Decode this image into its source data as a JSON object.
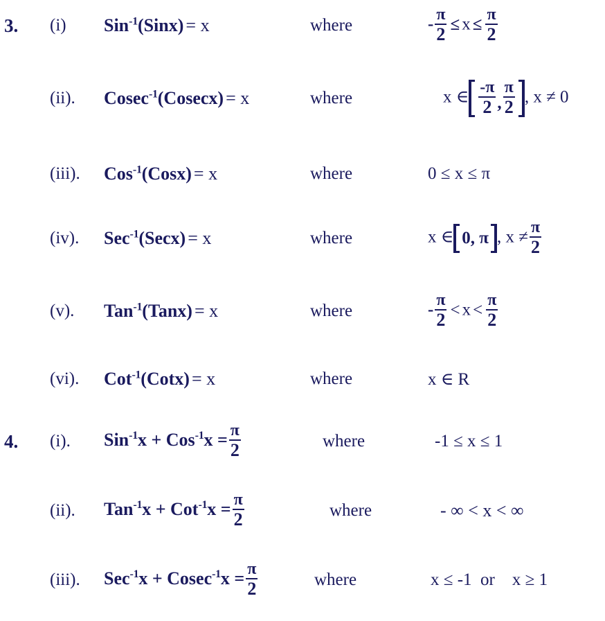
{
  "document": {
    "text_color": "#1a1a5e",
    "background_color": "#ffffff",
    "where_label": "where"
  },
  "groups": [
    {
      "number": "3.",
      "items": [
        {
          "label": "(i)",
          "formula": {
            "func": "Sin",
            "inverse": "-1",
            "arg": "(Sinx)",
            "equals": "= x"
          },
          "where": "where",
          "condition": {
            "type": "fraction_inequality",
            "lead": "-",
            "left_num": "π",
            "left_den": "2",
            "rel1": "≤",
            "var": "x",
            "rel2": "≤",
            "right_num": "π",
            "right_den": "2",
            "text": "-π/2 ≤ x ≤ π/2"
          }
        },
        {
          "label": "(ii).",
          "formula": {
            "func": "Cosec",
            "inverse": "-1",
            "arg": "(Cosecx)",
            "equals": "= x"
          },
          "where": "where",
          "condition": {
            "type": "interval_bracket_two_fractions",
            "member": "x ∈",
            "left_num": "-π",
            "left_den": "2",
            "sep": ",",
            "right_num": "π",
            "right_den": "2",
            "suffix": ", x ≠ 0",
            "text": "x ∈ [-π/2, π/2], x ≠ 0"
          }
        },
        {
          "label": "(iii).",
          "formula": {
            "func": "Cos",
            "inverse": "-1",
            "arg": "(Cosx)",
            "equals": "= x"
          },
          "where": "where",
          "condition": {
            "type": "simple",
            "text": "0 ≤ x ≤ π"
          }
        },
        {
          "label": "(iv).",
          "formula": {
            "func": "Sec",
            "inverse": "-1",
            "arg": "(Secx)",
            "equals": "= x"
          },
          "where": "where",
          "condition": {
            "type": "interval_bracket_plain",
            "member": "x ∈",
            "inner": "0, π",
            "mid": ", x ≠",
            "frac_num": "π",
            "frac_den": "2",
            "text": "x ∈ [0, π], x ≠ π/2"
          }
        },
        {
          "label": "(v).",
          "formula": {
            "func": "Tan",
            "inverse": "-1",
            "arg": "(Tanx)",
            "equals": "= x"
          },
          "where": "where",
          "condition": {
            "type": "fraction_inequality",
            "lead": "-",
            "left_num": "π",
            "left_den": "2",
            "rel1": "<",
            "var": "x",
            "rel2": "<",
            "right_num": "π",
            "right_den": "2",
            "text": "-π/2 < x < π/2"
          }
        },
        {
          "label": "(vi).",
          "formula": {
            "func": "Cot",
            "inverse": "-1",
            "arg": "(Cotx)",
            "equals": "= x"
          },
          "where": "where",
          "condition": {
            "type": "simple",
            "text": "x ∈ R"
          }
        }
      ]
    },
    {
      "number": "4.",
      "items": [
        {
          "label": "(i).",
          "formula": {
            "func": "Sin",
            "inverse": "-1",
            "arg": "x + Cos",
            "inverse2": "-1",
            "arg2": "x =",
            "frac_num": "π",
            "frac_den": "2"
          },
          "where": "where",
          "condition": {
            "type": "simple",
            "text": "-1 ≤ x ≤ 1"
          }
        },
        {
          "label": "(ii).",
          "formula": {
            "func": "Tan",
            "inverse": "-1",
            "arg": "x + Cot",
            "inverse2": "-1",
            "arg2": "x =",
            "frac_num": "π",
            "frac_den": "2"
          },
          "where": "where",
          "condition": {
            "type": "simple",
            "text": "- ∞ < x < ∞"
          }
        },
        {
          "label": "(iii).",
          "formula": {
            "func": "Sec",
            "inverse": "-1",
            "arg": "x + Cosec",
            "inverse2": "-1",
            "arg2": "x =",
            "frac_num": "π",
            "frac_den": "2"
          },
          "where": "where",
          "condition": {
            "type": "simple",
            "text": "x ≤ -1  or    x ≥ 1"
          }
        }
      ]
    }
  ]
}
